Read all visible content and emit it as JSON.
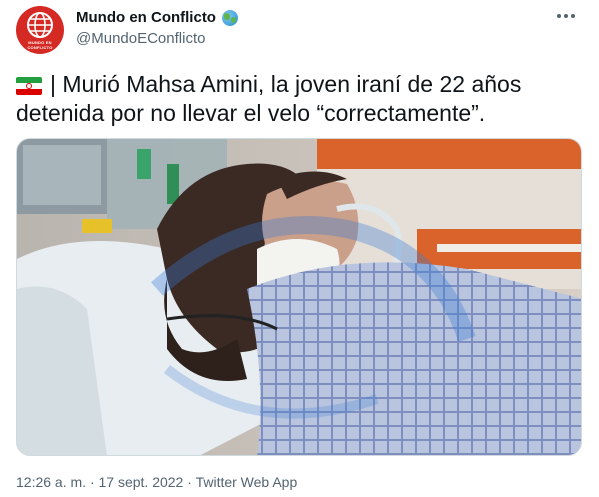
{
  "account": {
    "display_name": "Mundo en Conflicto",
    "handle": "@MundoEConflicto",
    "avatar_text": "MUNDO EN CONFLICTO",
    "badge_icon": "globe-emoji-icon"
  },
  "tweet": {
    "flag_icon": "iran-flag-icon",
    "text": "| Murió Mahsa Amini, la joven iraní de 22 años detenida por no llevar el velo “correctamente”.",
    "image_description_icon": "hospital-photo"
  },
  "meta": {
    "time": "12:26 a. m.",
    "separator": "·",
    "date": "17 sept. 2022",
    "app": "Twitter Web App"
  },
  "colors": {
    "accent": "#1d9bf0",
    "secondary_text": "#536471",
    "avatar_red": "#d52a24"
  }
}
